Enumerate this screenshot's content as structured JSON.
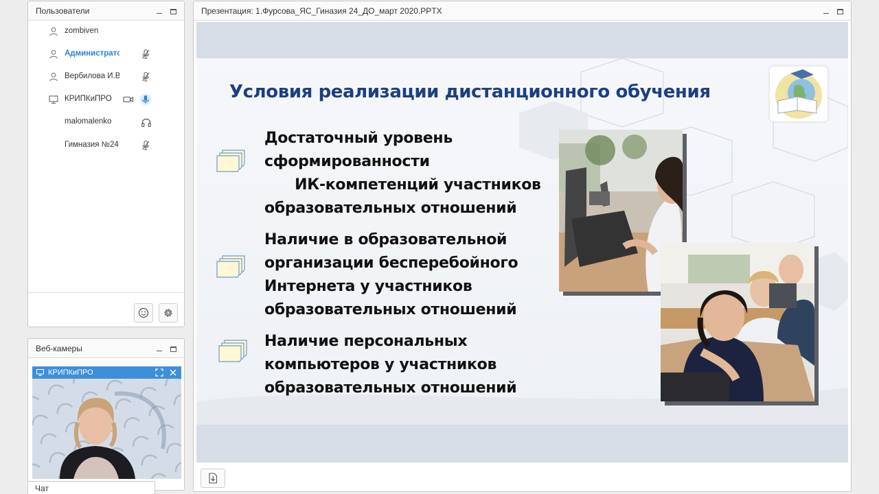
{
  "users_panel": {
    "title": "Пользователи",
    "users": [
      {
        "name": "zombiven",
        "icon": "user-icon"
      },
      {
        "name": "Администрато",
        "icon": "user-icon",
        "active": true,
        "mic": "mic-muted-icon"
      },
      {
        "name": "Вербилова И.В",
        "icon": "user-icon",
        "mic": "mic-muted-icon"
      },
      {
        "name": "КРИПКиПРО",
        "icon": "screen-icon",
        "camera": "camera-icon",
        "mic": "mic-active-icon"
      },
      {
        "name": "malomalenko",
        "icon": "",
        "mic": "headphones-icon"
      },
      {
        "name": "Гимназия №24",
        "icon": "",
        "mic": "mic-muted-icon"
      }
    ],
    "footer_buttons": [
      "smiley-icon",
      "gear-icon"
    ]
  },
  "webcam_panel": {
    "title": "Веб-камеры",
    "stream": {
      "title": "КРИПКиПРО"
    }
  },
  "chat_tab": {
    "label": "Чат"
  },
  "presentation": {
    "title": "Презентация: 1.Фурсова_ЯС_Гиназия 24_ДО_март 2020.PPTX",
    "slide": {
      "title": "Условия реализации  дистанционного обучения",
      "bullets": [
        {
          "lines": [
            "Достаточный уровень",
            "сформированности",
            "      ИК-компетенций участников",
            "образовательных отношений"
          ]
        },
        {
          "lines": [
            "Наличие в образовательной",
            "организации  бесперебойного",
            "Интернета у участников",
            "образовательных отношений"
          ]
        },
        {
          "lines": [
            "Наличие персональных",
            "компьютеров  у участников",
            "образовательных отношений"
          ]
        }
      ]
    },
    "download_button": "download-icon"
  },
  "colors": {
    "accent": "#2a84d6",
    "slide_title": "#1c3f83",
    "webcam_bar": "#3f8fd8",
    "mic_active": "#2a84d6"
  }
}
